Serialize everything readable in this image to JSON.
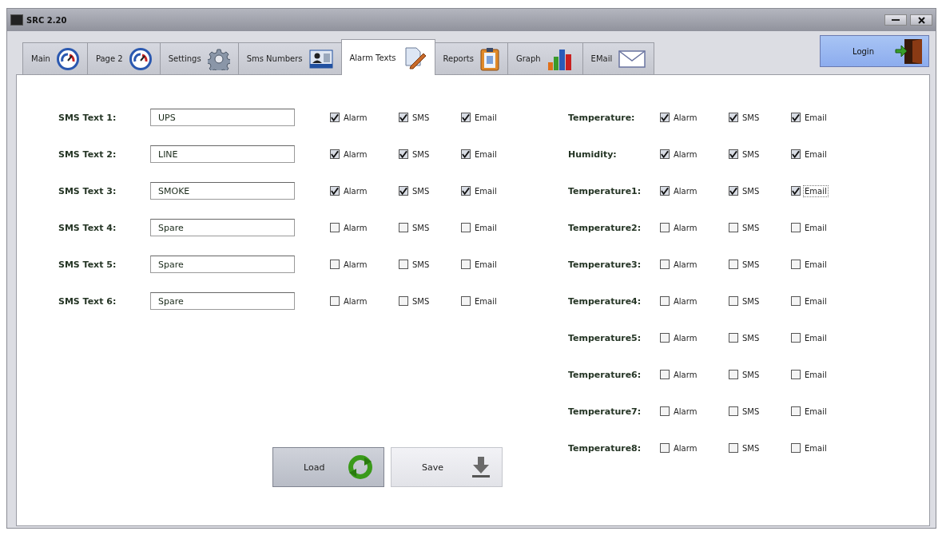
{
  "window": {
    "title": "SRC 2.20"
  },
  "tabs": [
    {
      "label": "Main",
      "selected": false
    },
    {
      "label": "Page 2",
      "selected": false
    },
    {
      "label": "Settings",
      "selected": false
    },
    {
      "label": "Sms Numbers",
      "selected": false
    },
    {
      "label": "Alarm Texts",
      "selected": true
    },
    {
      "label": "Reports",
      "selected": false
    },
    {
      "label": "Graph",
      "selected": false
    },
    {
      "label": "EMail",
      "selected": false
    }
  ],
  "login_button": {
    "label": "Login"
  },
  "sms_texts": [
    {
      "label": "SMS Text 1:",
      "value": "UPS",
      "options": [
        {
          "label": "Alarm",
          "checked": true,
          "focused": false
        },
        {
          "label": "SMS",
          "checked": true,
          "focused": false
        },
        {
          "label": "Email",
          "checked": true,
          "focused": false
        }
      ]
    },
    {
      "label": "SMS Text 2:",
      "value": "LINE",
      "options": [
        {
          "label": "Alarm",
          "checked": true,
          "focused": false
        },
        {
          "label": "SMS",
          "checked": true,
          "focused": false
        },
        {
          "label": "Email",
          "checked": true,
          "focused": false
        }
      ]
    },
    {
      "label": "SMS Text 3:",
      "value": "SMOKE",
      "options": [
        {
          "label": "Alarm",
          "checked": true,
          "focused": false
        },
        {
          "label": "SMS",
          "checked": true,
          "focused": false
        },
        {
          "label": "Email",
          "checked": true,
          "focused": false
        }
      ]
    },
    {
      "label": "SMS Text 4:",
      "value": "Spare",
      "options": [
        {
          "label": "Alarm",
          "checked": false,
          "focused": false
        },
        {
          "label": "SMS",
          "checked": false,
          "focused": false
        },
        {
          "label": "Email",
          "checked": false,
          "focused": false
        }
      ]
    },
    {
      "label": "SMS Text 5:",
      "value": "Spare",
      "options": [
        {
          "label": "Alarm",
          "checked": false,
          "focused": false
        },
        {
          "label": "SMS",
          "checked": false,
          "focused": false
        },
        {
          "label": "Email",
          "checked": false,
          "focused": false
        }
      ]
    },
    {
      "label": "SMS Text 6:",
      "value": "Spare",
      "options": [
        {
          "label": "Alarm",
          "checked": false,
          "focused": false
        },
        {
          "label": "SMS",
          "checked": false,
          "focused": false
        },
        {
          "label": "Email",
          "checked": false,
          "focused": false
        }
      ]
    }
  ],
  "buttons": [
    {
      "label": "Load",
      "pressed": true
    },
    {
      "label": "Save",
      "pressed": false
    }
  ],
  "sensors": [
    {
      "label": "Temperature:",
      "options": [
        {
          "label": "Alarm",
          "checked": true,
          "focused": false
        },
        {
          "label": "SMS",
          "checked": true,
          "focused": false
        },
        {
          "label": "Email",
          "checked": true,
          "focused": false
        }
      ]
    },
    {
      "label": "Humidity:",
      "options": [
        {
          "label": "Alarm",
          "checked": true,
          "focused": false
        },
        {
          "label": "SMS",
          "checked": true,
          "focused": false
        },
        {
          "label": "Email",
          "checked": true,
          "focused": false
        }
      ]
    },
    {
      "label": "Temperature1:",
      "options": [
        {
          "label": "Alarm",
          "checked": true,
          "focused": false
        },
        {
          "label": "SMS",
          "checked": true,
          "focused": false
        },
        {
          "label": "Email",
          "checked": true,
          "focused": true
        }
      ]
    },
    {
      "label": "Temperature2:",
      "options": [
        {
          "label": "Alarm",
          "checked": false,
          "focused": false
        },
        {
          "label": "SMS",
          "checked": false,
          "focused": false
        },
        {
          "label": "Email",
          "checked": false,
          "focused": false
        }
      ]
    },
    {
      "label": "Temperature3:",
      "options": [
        {
          "label": "Alarm",
          "checked": false,
          "focused": false
        },
        {
          "label": "SMS",
          "checked": false,
          "focused": false
        },
        {
          "label": "Email",
          "checked": false,
          "focused": false
        }
      ]
    },
    {
      "label": "Temperature4:",
      "options": [
        {
          "label": "Alarm",
          "checked": false,
          "focused": false
        },
        {
          "label": "SMS",
          "checked": false,
          "focused": false
        },
        {
          "label": "Email",
          "checked": false,
          "focused": false
        }
      ]
    },
    {
      "label": "Temperature5:",
      "options": [
        {
          "label": "Alarm",
          "checked": false,
          "focused": false
        },
        {
          "label": "SMS",
          "checked": false,
          "focused": false
        },
        {
          "label": "Email",
          "checked": false,
          "focused": false
        }
      ]
    },
    {
      "label": "Temperature6:",
      "options": [
        {
          "label": "Alarm",
          "checked": false,
          "focused": false
        },
        {
          "label": "SMS",
          "checked": false,
          "focused": false
        },
        {
          "label": "Email",
          "checked": false,
          "focused": false
        }
      ]
    },
    {
      "label": "Temperature7:",
      "options": [
        {
          "label": "Alarm",
          "checked": false,
          "focused": false
        },
        {
          "label": "SMS",
          "checked": false,
          "focused": false
        },
        {
          "label": "Email",
          "checked": false,
          "focused": false
        }
      ]
    },
    {
      "label": "Temperature8:",
      "options": [
        {
          "label": "Alarm",
          "checked": false,
          "focused": false
        },
        {
          "label": "SMS",
          "checked": false,
          "focused": false
        },
        {
          "label": "Email",
          "checked": false,
          "focused": false
        }
      ]
    }
  ]
}
